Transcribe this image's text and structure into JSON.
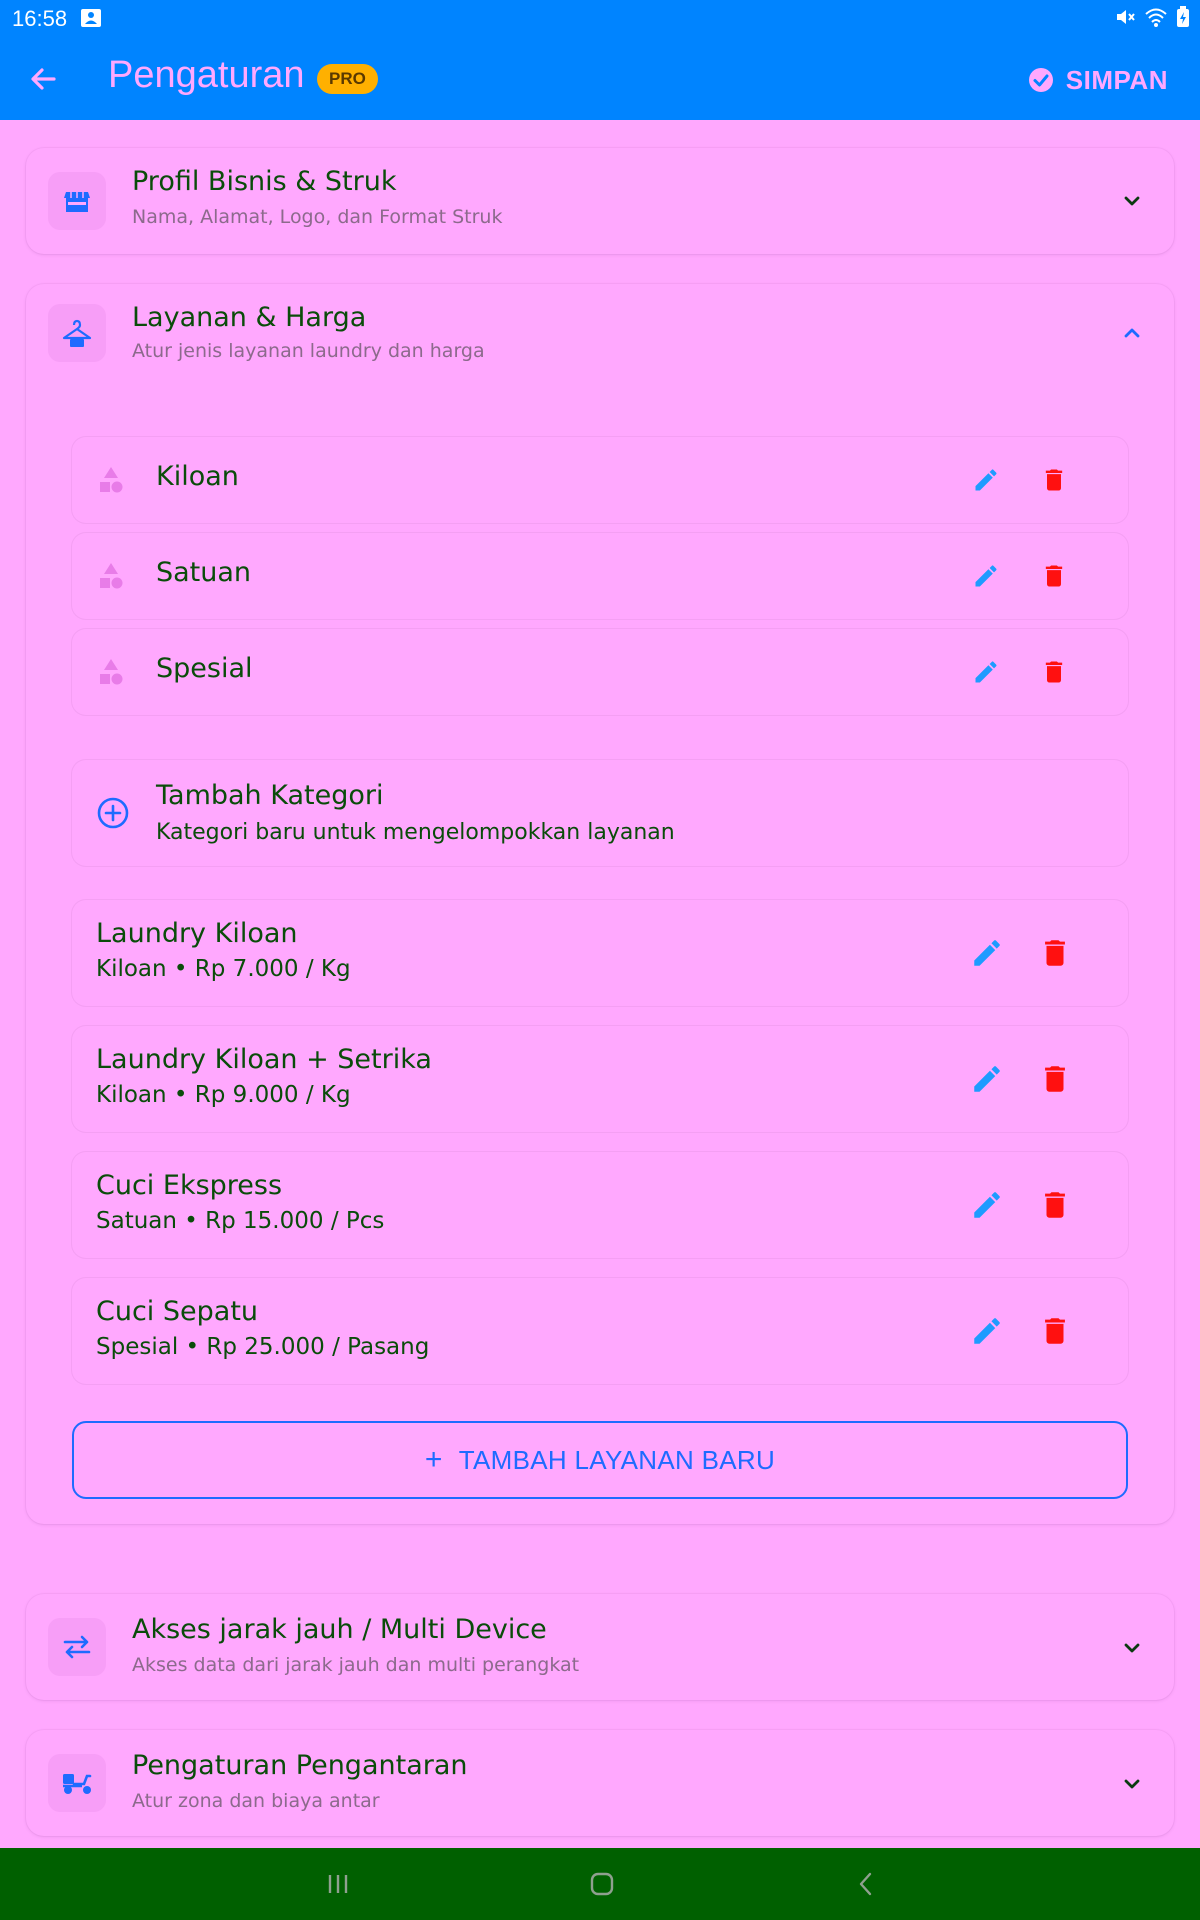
{
  "status": {
    "time": "16:58"
  },
  "appbar": {
    "title": "Pengaturan",
    "badge": "PRO",
    "save_label": "SIMPAN"
  },
  "sections": {
    "profile": {
      "title": "Profil Bisnis & Struk",
      "subtitle": "Nama, Alamat, Logo, dan Format Struk",
      "icon": "store-icon"
    },
    "services": {
      "title": "Layanan & Harga",
      "subtitle": "Atur jenis layanan laundry dan harga",
      "icon": "hanger-icon"
    },
    "remote": {
      "title": "Akses jarak jauh / Multi Device",
      "subtitle": "Akses data dari jarak jauh dan multi perangkat",
      "icon": "swap-icon"
    },
    "delivery": {
      "title": "Pengaturan Pengantaran",
      "subtitle": "Atur zona dan biaya antar",
      "icon": "scooter-icon"
    }
  },
  "categories": [
    {
      "label": "Kiloan"
    },
    {
      "label": "Satuan"
    },
    {
      "label": "Spesial"
    }
  ],
  "add_category": {
    "title": "Tambah Kategori",
    "subtitle": "Kategori baru untuk mengelompokkan layanan"
  },
  "services_list": [
    {
      "name": "Laundry Kiloan",
      "detail": "Kiloan • Rp 7.000 / Kg"
    },
    {
      "name": "Laundry Kiloan + Setrika",
      "detail": "Kiloan • Rp 9.000 / Kg"
    },
    {
      "name": "Cuci Ekspress",
      "detail": "Satuan • Rp 15.000 / Pcs"
    },
    {
      "name": "Cuci Sepatu",
      "detail": "Spesial • Rp 25.000 / Pasang"
    }
  ],
  "add_service_label": "TAMBAH LAYANAN BARU",
  "colors": {
    "appbar": "#0084FF",
    "background": "#FFA8FE",
    "title_text": "#0A4C0A",
    "edit": "#1E9BFF",
    "delete": "#FF1010",
    "badge": "#FFB000",
    "navbar": "#006000"
  }
}
